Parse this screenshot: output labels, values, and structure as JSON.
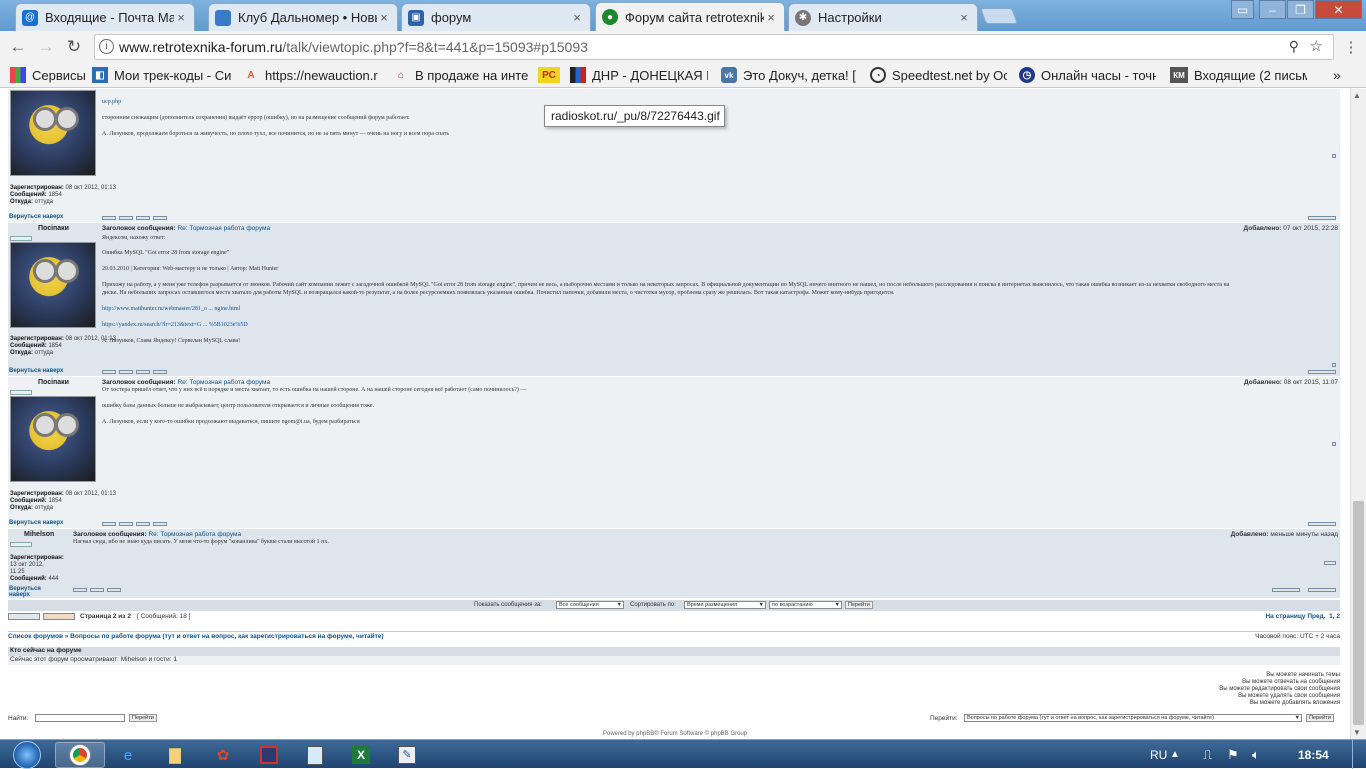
{
  "browser": {
    "tabs": [
      {
        "label": "Входящие - Почта Mail.R",
        "icon": "mail-icon",
        "color": "#1a6fd1"
      },
      {
        "label": "Клуб Дальномер • Новы",
        "icon": "page-icon",
        "color": "#3a78c8"
      },
      {
        "label": "форум",
        "icon": "forum-icon",
        "color": "#2d63a7"
      },
      {
        "label": "Форум сайта retrotexnik",
        "icon": "retro-icon",
        "color": "#1b8a2a",
        "active": true
      },
      {
        "label": "Настройки",
        "icon": "gear-icon",
        "color": "#777777"
      }
    ],
    "close_glyph": "×",
    "url_host": "www.retrotexnika-forum.ru",
    "url_path": "/talk/viewtopic.php?f=8&t=441&p=15093#p15093",
    "bookmarks": [
      {
        "label": "Сервисы",
        "icon": "apps-icon"
      },
      {
        "label": "Мои трек-коды - Сис",
        "icon": "box-icon"
      },
      {
        "label": "https://newauction.ru",
        "icon": "auction-icon"
      },
      {
        "label": "В продаже на интер",
        "icon": "shop-icon"
      },
      {
        "label": "",
        "icon": "rc-icon"
      },
      {
        "label": "ДНР - ДОНЕЦКАЯ НА",
        "icon": "flag-icon"
      },
      {
        "label": "Это Докуч, детка! [Ти",
        "icon": "vk-icon"
      },
      {
        "label": "Speedtest.net by Ook",
        "icon": "speedtest-icon"
      },
      {
        "label": "Онлайн часы - точно",
        "icon": "clock-icon"
      },
      {
        "label": "Входящие (2 письма)",
        "icon": "km-icon"
      }
    ],
    "bookmarks_more": "»"
  },
  "tooltip": "radioskot.ru/_pu/8/72276443.gif",
  "posts": [
    {
      "author": "",
      "lines": [
        "ucp.php",
        "сторонним снежащим (дополнитель сохранения) выдаёт еррор (ошибку), но на размещение сообщений форум работает.",
        "А. Лизунков, продолжаем бороться за живучесть, но плохо тухл, все починится, но не за пять минут — очень на ногу и всем пора спать"
      ],
      "reg_label": "Зарегистрирован:",
      "reg": "08 окт 2012, 01:13",
      "msgs_label": "Сообщений:",
      "msgs": "1854",
      "from_label": "Откуда:",
      "from": "оттуда",
      "back": "Вернуться наверх"
    },
    {
      "author": "Посіпаки",
      "subject_label": "Заголовок сообщения:",
      "subject": "Re: Тормозная работа форума",
      "posted_label": "Добавлено:",
      "posted": "07 окт 2015, 22:28",
      "lines": [
        "Яндексом, нахожу ответ:",
        "Ошибка MySQL \"Got error 28 from storage engine\"",
        "20.03.2010 | Категория: Web-мастеру и не только | Автор: Matt Hunter",
        "Прихожу на работу, а у меня уже телефон разрывается от звонков. Рабочий сайт компании лежит с загадочной ошибкой MySQL \"Got error 28 from storage engine\", причем не весь, а выборочно местами и только на некоторых запросах. В официальной документации по MySQL ничего внятного не нашел, но после небольшого расследования и поиска в интернетах выяснилось, что такая ошибка возникает из-за нехватки свободного места на",
        "диске. На небольших запросах оставшегося места хватало для работы MySQL и возвращался какой-то результат, а на более ресурсоемких появлялась указанная ошибка. Почистил папочки, добавили места, о чистотки мусор, проблема сразу же решилась. Вот такая катастрофа. Может кому-нибудь пригодится.",
        "http://www.matthunter.ru/webmaster/281_o ... ngine.html",
        "https://yandex.ru/search/?lr=213&text=G ... %5B1023e%5D",
        "А. Лизунков, Слава Яндексу! Сервелан MySQL слава!"
      ],
      "reg_label": "Зарегистрирован:",
      "reg": "08 окт 2012, 01:13",
      "msgs_label": "Сообщений:",
      "msgs": "1854",
      "from_label": "Откуда:",
      "from": "оттуда",
      "back": "Вернуться наверх"
    },
    {
      "author": "Посіпаки",
      "subject_label": "Заголовок сообщения:",
      "subject": "Re: Тормозная работа форума",
      "posted_label": "Добавлено:",
      "posted": "08 окт 2015, 11:07",
      "lines": [
        "От хостера пришёл ответ, что у них всё в порядке и места хватает, то есть ошибка на нашей стороне. А на нашей стороне сегодня всё работает (само починилось?) —",
        "ошибку базы данных больше не выбрасывает, центр пользователя открывается и личные сообщения тоже.",
        "А. Лизунков, если у кого-то ошибки продолжают выдаваться, пишите ngom@i.ua, будем разбираться"
      ],
      "reg_label": "Зарегистрирован:",
      "reg": "08 окт 2012, 01:13",
      "msgs_label": "Сообщений:",
      "msgs": "1854",
      "from_label": "Откуда:",
      "from": "оттуда",
      "back": "Вернуться наверх"
    },
    {
      "author": "Mihelson",
      "subject_label": "Заголовок сообщения:",
      "subject": "Re: Тормозная работа форума",
      "posted_label": "Добавлено:",
      "posted": "меньше минуты назад",
      "lines": [
        "Нагнал сюда, ибо не знаю куда писать. У меня что-то форум \"кованлива\" буквы стали высотой 1 пх."
      ],
      "reg_label": "Зарегистрирован:",
      "reg": "13 окт 2012, 11:25",
      "msgs_label": "Сообщений:",
      "msgs": "444",
      "back": "Вернуться наверх"
    }
  ],
  "bottom": {
    "show_label": "Показать сообщения за:",
    "show_value": "Все сообщения",
    "sort_label": "Сортировать по:",
    "sort_value": "Время размещения",
    "order_value": "по возрастанию",
    "go": "Перейти"
  },
  "pagination": {
    "page": "Страница 2 из 2",
    "count": "[ Сообщений: 18 ]",
    "goto": "На страницу",
    "prev": "Пред.",
    "pages": "1, 2"
  },
  "crumbs": {
    "path": "Список форумов » Вопросы по работе форума (тут и ответ на вопрос, как зарегистрироваться на форуме, читайте)",
    "tz": "Часовой пояс: UTC + 2 часа"
  },
  "online": {
    "title": "Кто сейчас на форуме",
    "text": "Сейчас этот форум просматривают: Mihelson и гости: 1"
  },
  "permissions": [
    "Вы можете начинать темы",
    "Вы можете отвечать на сообщения",
    "Вы можете редактировать свои сообщения",
    "Вы можете удалять свои сообщения",
    "Вы можете добавлять вложения"
  ],
  "jump": {
    "search_label": "Найти:",
    "search_btn": "Перейти",
    "goto_label": "Перейти:",
    "goto_value": "Вопросы по работе форума (тут и ответ на вопрос, как зарегистрироваться на форуме, читайте)",
    "goto_btn": "Перейти"
  },
  "footer": "Powered by phpBB® Forum Software © phpBB Group",
  "tray": {
    "lang": "RU",
    "time": "18:54"
  }
}
